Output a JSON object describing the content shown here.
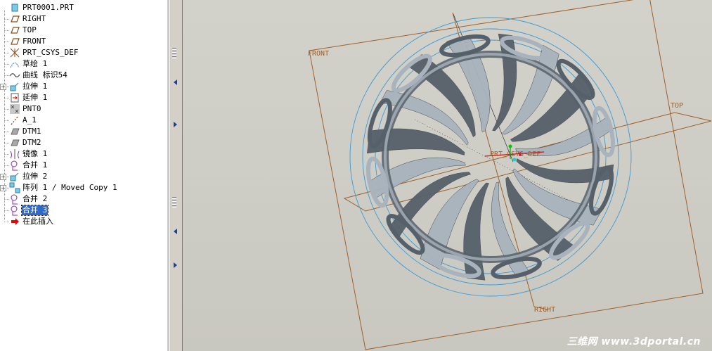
{
  "model_tree": {
    "items": [
      {
        "label": "PRT0001.PRT",
        "icon": "part-icon"
      },
      {
        "label": "RIGHT",
        "icon": "datum-plane-icon"
      },
      {
        "label": "TOP",
        "icon": "datum-plane-icon"
      },
      {
        "label": "FRONT",
        "icon": "datum-plane-icon"
      },
      {
        "label": "PRT_CSYS_DEF",
        "icon": "coordinate-system-icon"
      },
      {
        "label": "草绘 1",
        "icon": "sketch-icon"
      },
      {
        "label": "曲线 标识54",
        "icon": "curve-icon"
      },
      {
        "label": "拉伸 1",
        "icon": "extrude-icon"
      },
      {
        "label": "延伸 1",
        "icon": "extend-icon"
      },
      {
        "label": "PNT0",
        "icon": "datum-point-icon"
      },
      {
        "label": "A_1",
        "icon": "datum-axis-icon"
      },
      {
        "label": "DTM1",
        "icon": "datum-plane-gray-icon"
      },
      {
        "label": "DTM2",
        "icon": "datum-plane-gray-icon"
      },
      {
        "label": "镜像 1",
        "icon": "mirror-icon"
      },
      {
        "label": "合并 1",
        "icon": "merge-icon"
      },
      {
        "label": "拉伸 2",
        "icon": "extrude-icon"
      },
      {
        "label": "阵列 1 / Moved Copy 1",
        "icon": "pattern-icon"
      },
      {
        "label": "合并 2",
        "icon": "merge-icon"
      },
      {
        "label": "合并 3",
        "icon": "merge-icon",
        "selected": true
      },
      {
        "label": "在此插入",
        "icon": "insert-here-arrow-icon"
      }
    ]
  },
  "viewport": {
    "datum_labels": {
      "front": "FRONT",
      "top": "TOP",
      "right": "RIGHT",
      "csys": "PRT_CSYS_DEF"
    },
    "watermark": "三维网 www.3dportal.cn"
  },
  "colors": {
    "datum_plane": "#a0602a",
    "sketch_circle": "#3a9ad8",
    "surface_dark": "#56606a",
    "surface_light": "#a9b3bd",
    "selection": "#3169c6"
  }
}
